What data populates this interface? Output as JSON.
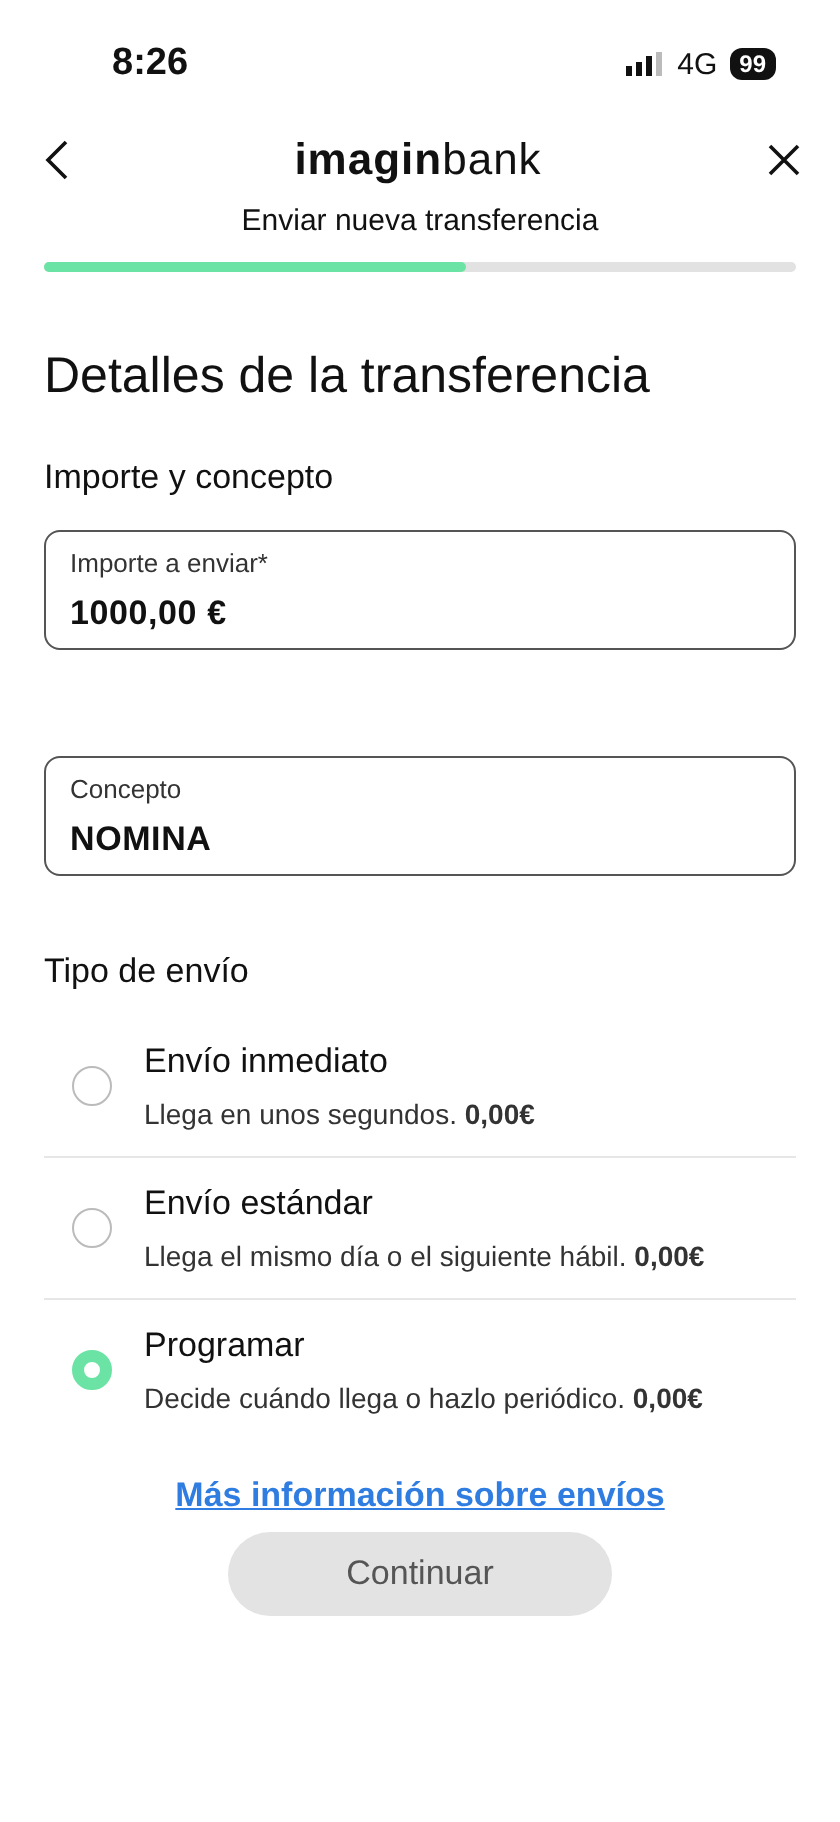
{
  "status_bar": {
    "time": "8:26",
    "network": "4G",
    "battery": "99"
  },
  "header": {
    "logo": "**imagin**bank",
    "subtitle": "Enviar nueva transferencia",
    "progress": {
      "level": 0.56
    }
  },
  "title": "Detalles de la transferencia",
  "amount_section": {
    "heading": "Importe y concepto",
    "fields": [
      {
        "label": "Importe a enviar*",
        "value": "1000,00 €"
      },
      {
        "label": "Concepto",
        "value": "NOMINA"
      }
    ]
  },
  "shipping": {
    "heading": "Tipo de envío",
    "options": [
      {
        "title": "Envío inmediato",
        "description": "Llega en unos segundos. **0,00€**",
        "selected": false
      },
      {
        "title": "Envío estándar",
        "description": "Llega el mismo día o el siguiente hábil. **0,00€**",
        "selected": false
      },
      {
        "title": "Programar",
        "description": "Decide cuándo llega o hazlo periódico. **0,00€**",
        "selected": true
      }
    ]
  },
  "info_link": "Más información sobre envíos",
  "continue_button": {
    "label": "Continuar",
    "disabled": true
  }
}
